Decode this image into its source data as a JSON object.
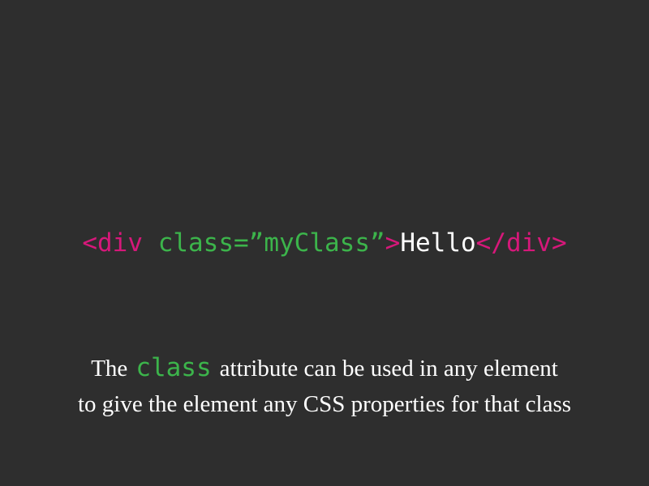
{
  "code": {
    "open_tag": "<div ",
    "attribute": "class=”myClass”",
    "open_close": ">",
    "content": "Hello",
    "close_tag": "</div>"
  },
  "caption": {
    "line1_prefix": "The",
    "keyword": "class",
    "line1_suffix": "attribute can be used in any element",
    "line2": "to give the element any CSS properties for that class"
  },
  "colors": {
    "background": "#2e2e2e",
    "tag": "#d6187a",
    "attribute": "#3cb44b",
    "text": "#ffffff"
  }
}
